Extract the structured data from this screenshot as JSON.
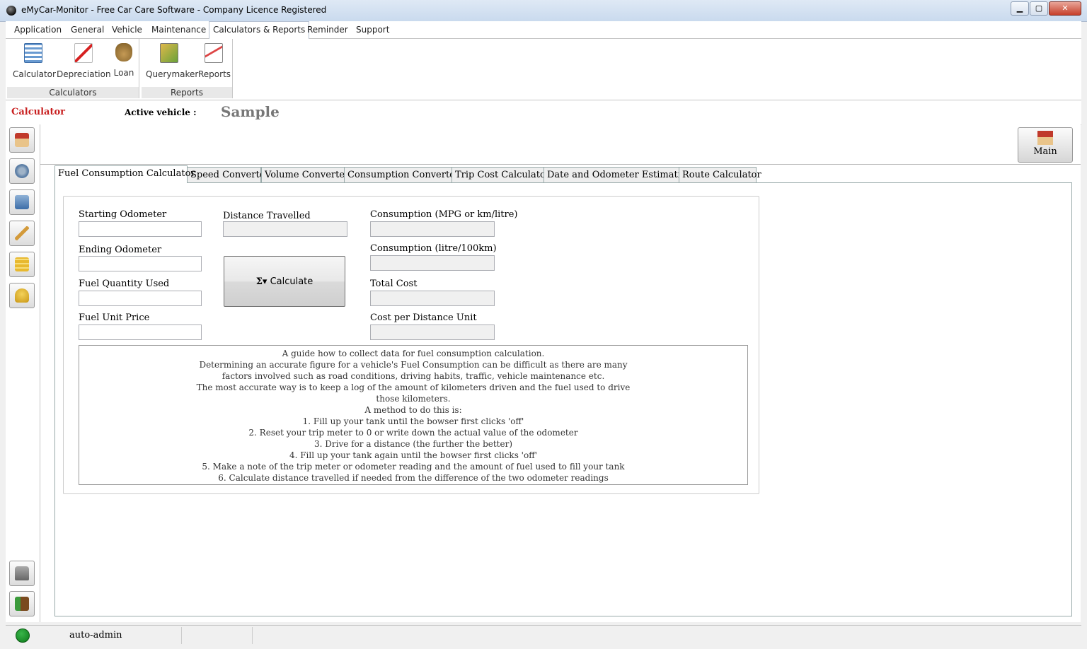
{
  "window": {
    "title": "eMyCar-Monitor - Free Car Care Software - Company Licence Registered"
  },
  "menu": {
    "items": [
      "Application",
      "General",
      "Vehicle",
      "Maintenance",
      "Calculators & Reports",
      "Reminder",
      "Support"
    ],
    "active": "Calculators & Reports"
  },
  "ribbon": {
    "calculators_group": "Calculators",
    "reports_group": "Reports",
    "calculator": "Calculator",
    "depreciation": "Depreciation",
    "loan": "Loan",
    "querymaker": "Querymaker",
    "reports": "Reports"
  },
  "breadcrumb": {
    "section": "Calculator",
    "active_vehicle_label": "Active vehicle :",
    "vehicle_name": "Sample"
  },
  "main_button": "Main",
  "tabs": [
    "Fuel Consumption Calculator",
    "Speed Converter",
    "Volume Converter",
    "Consumption Converter",
    "Trip Cost Calculator",
    "Date and Odometer Estimation",
    "Route Calculator"
  ],
  "form": {
    "starting_odometer": "Starting Odometer",
    "ending_odometer": "Ending Odometer",
    "fuel_quantity": "Fuel Quantity Used",
    "fuel_unit_price": "Fuel Unit Price",
    "distance_travelled": "Distance Travelled",
    "calculate": "Calculate",
    "consumption_mpg": "Consumption (MPG or km/litre)",
    "consumption_l100": "Consumption (litre/100km)",
    "total_cost": "Total Cost",
    "cost_per_distance": "Cost per Distance Unit"
  },
  "guide": [
    "A guide how to collect data for fuel consumption calculation.",
    "Determining an accurate figure for a vehicle's Fuel Consumption can be difficult as there are many",
    "factors involved such as road conditions, driving habits, traffic, vehicle maintenance etc.",
    "The most accurate way is to keep a log of the amount of kilometers driven and the fuel used to drive",
    "those kilometers.",
    "A method to do this is:",
    "1. Fill up your tank until the bowser first clicks 'off'",
    "2. Reset your trip meter to 0 or write down the actual value of the odometer",
    "3. Drive for a distance (the further the better)",
    "4. Fill up your tank again until the bowser first clicks 'off'",
    "5. Make a note of the trip meter or odometer reading and the amount of fuel used to fill your tank",
    "6. Calculate distance travelled if needed from the difference of the two odometer readings"
  ],
  "status": {
    "user": "auto-admin"
  }
}
